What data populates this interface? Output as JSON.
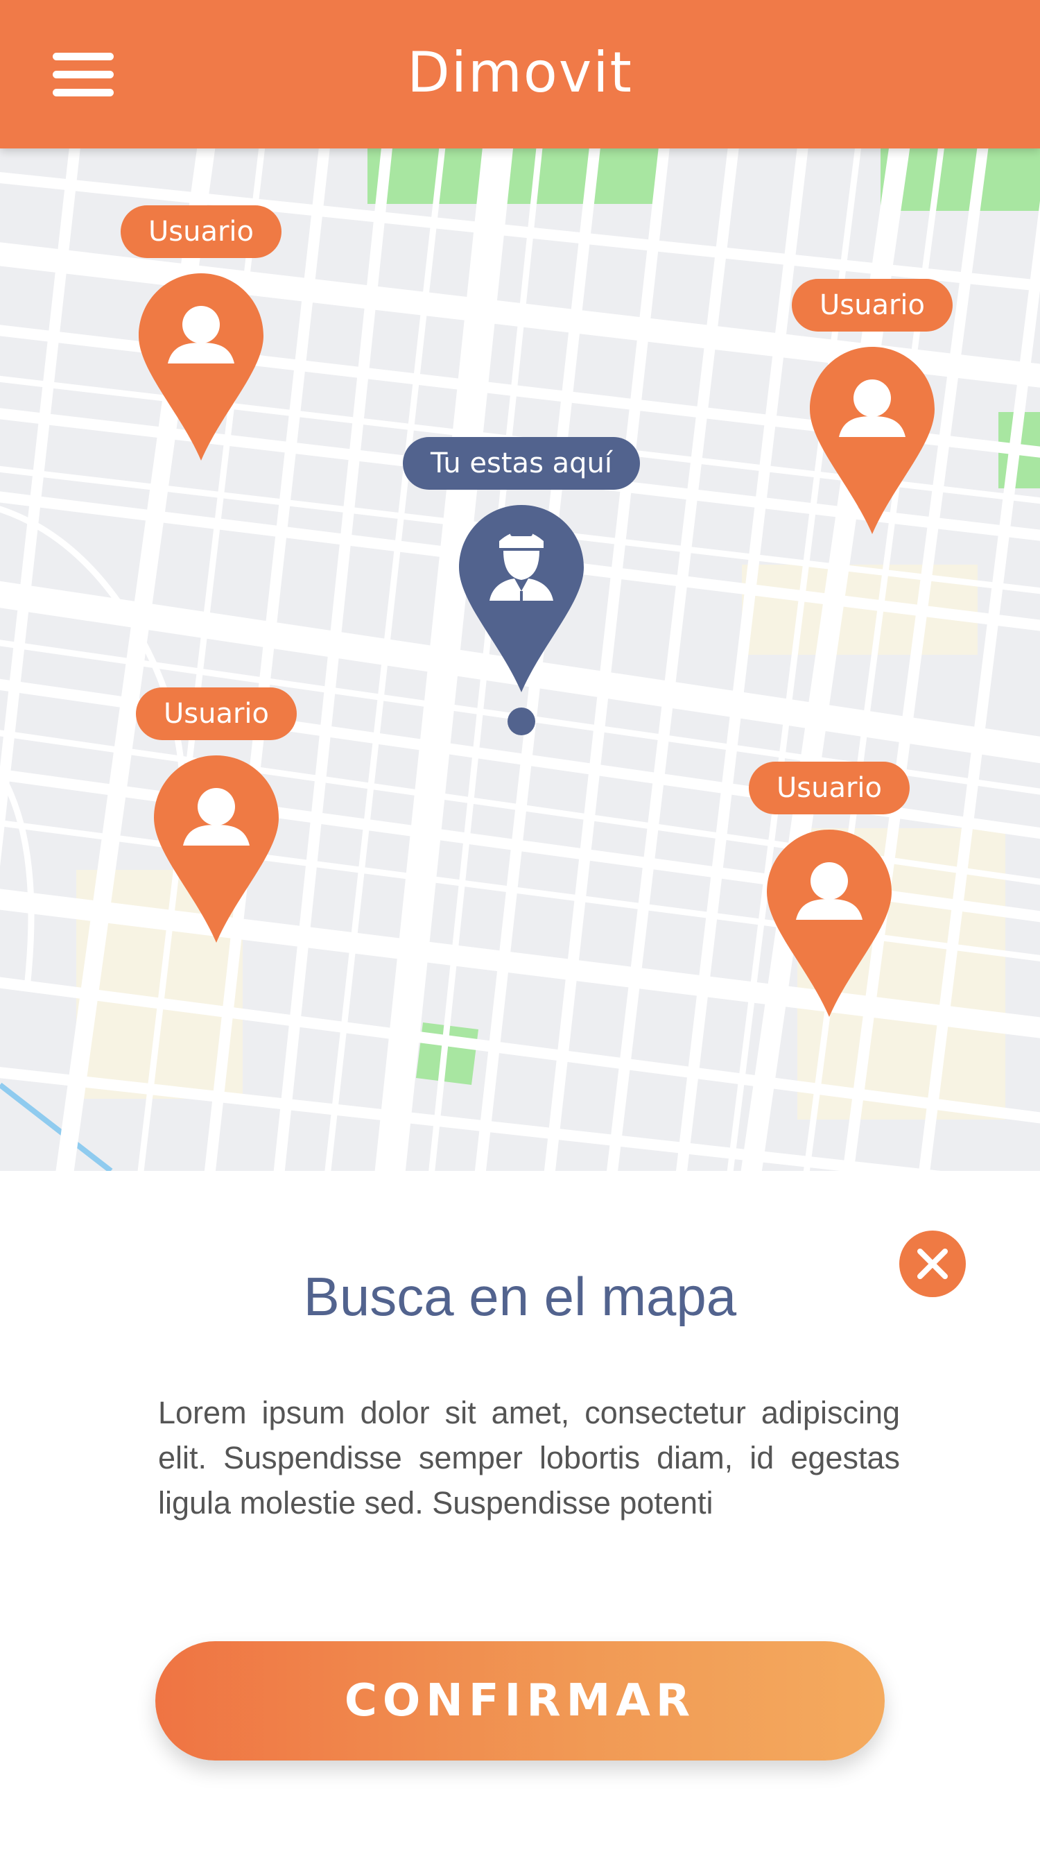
{
  "header": {
    "title": "Dimovit",
    "menu_icon": "hamburger-menu-icon",
    "background": "#F07A48"
  },
  "map": {
    "markers": [
      {
        "label": "Usuario",
        "kind": "user",
        "color": "#EF7A44"
      },
      {
        "label": "Usuario",
        "kind": "user",
        "color": "#EF7A44"
      },
      {
        "label": "Tu estas aquí",
        "kind": "self",
        "color": "#52638E"
      },
      {
        "label": "Usuario",
        "kind": "user",
        "color": "#EF7A44"
      },
      {
        "label": "Usuario",
        "kind": "user",
        "color": "#EF7A44"
      }
    ]
  },
  "panel": {
    "title": "Busca en el mapa",
    "body": "Lorem ipsum dolor sit amet, consectetur adipiscing elit. Suspendisse semper lobortis diam, id egestas ligula molestie sed. Suspendisse potenti",
    "confirm_label": "CONFIRMAR",
    "close_icon": "close-icon"
  }
}
